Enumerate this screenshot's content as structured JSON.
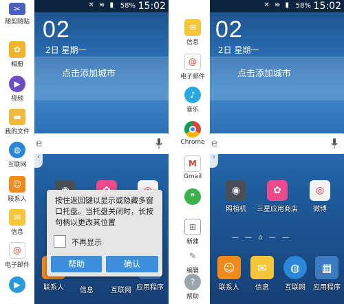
{
  "status_bar": {
    "battery": "58%",
    "time": "15:02"
  },
  "home": {
    "clock": "02",
    "date": "2日 星期一",
    "weather_prompt": "点击添加城市",
    "search_text": "e"
  },
  "left": {
    "tray_items": [
      {
        "label": "随剪随贴",
        "icon": "scrapbook-icon",
        "color": "#4a5fbf"
      },
      {
        "label": "相册",
        "icon": "gallery-icon",
        "color": "#f2b32b"
      },
      {
        "label": "视频",
        "icon": "video-icon",
        "color": "#6a4ec8"
      },
      {
        "label": "我的文件",
        "icon": "folder-icon",
        "color": "#f2b940"
      },
      {
        "label": "互联网",
        "icon": "globe-icon",
        "color": "#2a86d8"
      },
      {
        "label": "联系人",
        "icon": "contacts-icon",
        "color": "#f08a1c"
      },
      {
        "label": "信息",
        "icon": "message-icon",
        "color": "#f5c63a"
      },
      {
        "label": "电子邮件",
        "icon": "email-icon",
        "color": "#e04a3a"
      },
      {
        "label": "",
        "icon": "play-icon",
        "color": "#2a9ad8"
      }
    ],
    "dialog": {
      "text": "按住返回键以显示或隐藏多窗口托盘。当托盘关闭时，长按句柄以更改其位置",
      "checkbox_label": "不再显示",
      "help_button": "帮助",
      "ok_button": "确认"
    },
    "dock_labels": [
      "联系人",
      "信息",
      "互联网",
      "应用程序"
    ]
  },
  "right": {
    "tray_items": [
      {
        "label": "信息",
        "icon": "message-icon",
        "color": "#f5c63a"
      },
      {
        "label": "电子邮件",
        "icon": "email-icon",
        "color": "#e04a3a"
      },
      {
        "label": "音乐",
        "icon": "music-icon",
        "color": "#2aa8e0"
      },
      {
        "label": "Chrome",
        "icon": "chrome-icon",
        "color": "#e8e8e8"
      },
      {
        "label": "Gmail",
        "icon": "gmail-icon",
        "color": "#d64537"
      },
      {
        "label": "",
        "icon": "hangouts-icon",
        "color": "#3ab04a"
      },
      {
        "label": "新建",
        "icon": "new-window-icon",
        "color": "#9aa4ad"
      },
      {
        "label": "编辑",
        "icon": "edit-icon",
        "color": "#9aa4ad"
      },
      {
        "label": "帮助",
        "icon": "help-icon",
        "color": "#9aa4ad"
      }
    ],
    "apps": [
      {
        "label": "照相机",
        "icon": "camera-icon",
        "color": "#4a4f57"
      },
      {
        "label": "三星应用商店",
        "icon": "samsung-apps-icon",
        "color": "#e94a8a"
      },
      {
        "label": "微博",
        "icon": "weibo-icon",
        "color": "#f2f2f2"
      }
    ],
    "dock": [
      {
        "label": "联系人",
        "icon": "contacts-icon",
        "color": "#f08a1c"
      },
      {
        "label": "信息",
        "icon": "message-icon",
        "color": "#f5c63a"
      },
      {
        "label": "互联网",
        "icon": "globe-icon",
        "color": "#2a86d8"
      },
      {
        "label": "应用程序",
        "icon": "apps-grid-icon",
        "color": "#3a7ac0"
      }
    ]
  }
}
